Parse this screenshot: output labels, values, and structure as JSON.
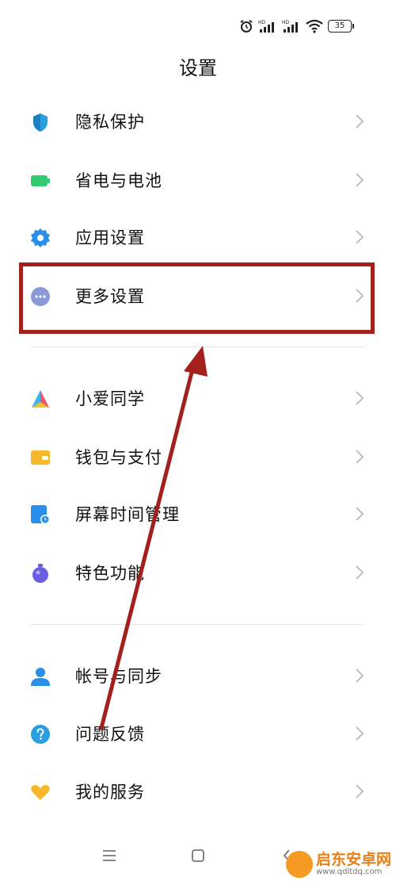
{
  "status": {
    "battery": "35",
    "sim1_label": "HD",
    "sim2_label": "HD"
  },
  "page_title": "设置",
  "settings_items": [
    {
      "label": "隐私保护",
      "icon": "privacy-shield-icon",
      "color": "#2a9fe0"
    },
    {
      "label": "省电与电池",
      "icon": "battery-icon",
      "color": "#2fcc71"
    },
    {
      "label": "应用设置",
      "icon": "app-settings-gear-icon",
      "color": "#2a8fe8"
    },
    {
      "label": "更多设置",
      "icon": "more-dots-icon",
      "color": "#8a9ad8"
    },
    {
      "label": "小爱同学",
      "icon": "xiaoai-icon",
      "color": "#3ab3f0"
    },
    {
      "label": "钱包与支付",
      "icon": "wallet-icon",
      "color": "#f5b82a"
    },
    {
      "label": "屏幕时间管理",
      "icon": "screen-time-icon",
      "color": "#2a8fe8"
    },
    {
      "label": "特色功能",
      "icon": "features-icon",
      "color": "#6a5ee0"
    },
    {
      "label": "帐号与同步",
      "icon": "account-icon",
      "color": "#2a8fe8"
    },
    {
      "label": "问题反馈",
      "icon": "feedback-question-icon",
      "color": "#2a9fe0"
    },
    {
      "label": "我的服务",
      "icon": "heart-service-icon",
      "color": "#f5b82a"
    }
  ],
  "highlight_color": "#a3201c",
  "watermark": {
    "main": "启东安卓网",
    "url": "www.qdltdq.com"
  }
}
